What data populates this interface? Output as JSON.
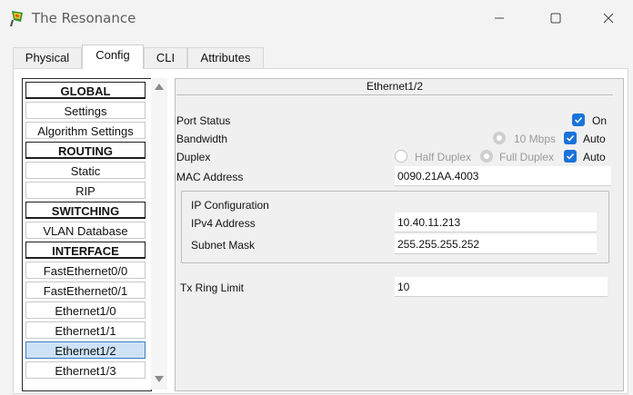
{
  "window": {
    "title": "The Resonance",
    "icons": {
      "app": "packet-tracer-app-icon",
      "minimize": "minimize-icon",
      "maximize": "maximize-icon",
      "close": "close-icon"
    }
  },
  "tabs": [
    {
      "label": "Physical",
      "active": false
    },
    {
      "label": "Config",
      "active": true
    },
    {
      "label": "CLI",
      "active": false
    },
    {
      "label": "Attributes",
      "active": false
    }
  ],
  "sidebar": {
    "items": [
      {
        "label": "GLOBAL",
        "type": "header"
      },
      {
        "label": "Settings",
        "type": "item"
      },
      {
        "label": "Algorithm Settings",
        "type": "item"
      },
      {
        "label": "ROUTING",
        "type": "header"
      },
      {
        "label": "Static",
        "type": "item"
      },
      {
        "label": "RIP",
        "type": "item"
      },
      {
        "label": "SWITCHING",
        "type": "header"
      },
      {
        "label": "VLAN Database",
        "type": "item"
      },
      {
        "label": "INTERFACE",
        "type": "header"
      },
      {
        "label": "FastEthernet0/0",
        "type": "item"
      },
      {
        "label": "FastEthernet0/1",
        "type": "item"
      },
      {
        "label": "Ethernet1/0",
        "type": "item"
      },
      {
        "label": "Ethernet1/1",
        "type": "item"
      },
      {
        "label": "Ethernet1/2",
        "type": "item",
        "selected": true
      },
      {
        "label": "Ethernet1/3",
        "type": "item"
      }
    ]
  },
  "interface": {
    "title": "Ethernet1/2",
    "port_status": {
      "label": "Port Status",
      "on_label": "On",
      "on_checked": true
    },
    "bandwidth": {
      "label": "Bandwidth",
      "speed_label": "10 Mbps",
      "auto_label": "Auto",
      "auto_checked": true
    },
    "duplex": {
      "label": "Duplex",
      "half_label": "Half Duplex",
      "full_label": "Full Duplex",
      "auto_label": "Auto",
      "auto_checked": true
    },
    "mac": {
      "label": "MAC Address",
      "value": "0090.21AA.4003"
    },
    "ip_config": {
      "title": "IP Configuration",
      "ipv4_label": "IPv4 Address",
      "ipv4_value": "10.40.11.213",
      "mask_label": "Subnet Mask",
      "mask_value": "255.255.255.252"
    },
    "tx_ring": {
      "label": "Tx Ring Limit",
      "value": "10"
    }
  },
  "colors": {
    "accent": "#1a73d9",
    "selected_bg": "#cde2f7",
    "selected_border": "#3d7bbf"
  }
}
